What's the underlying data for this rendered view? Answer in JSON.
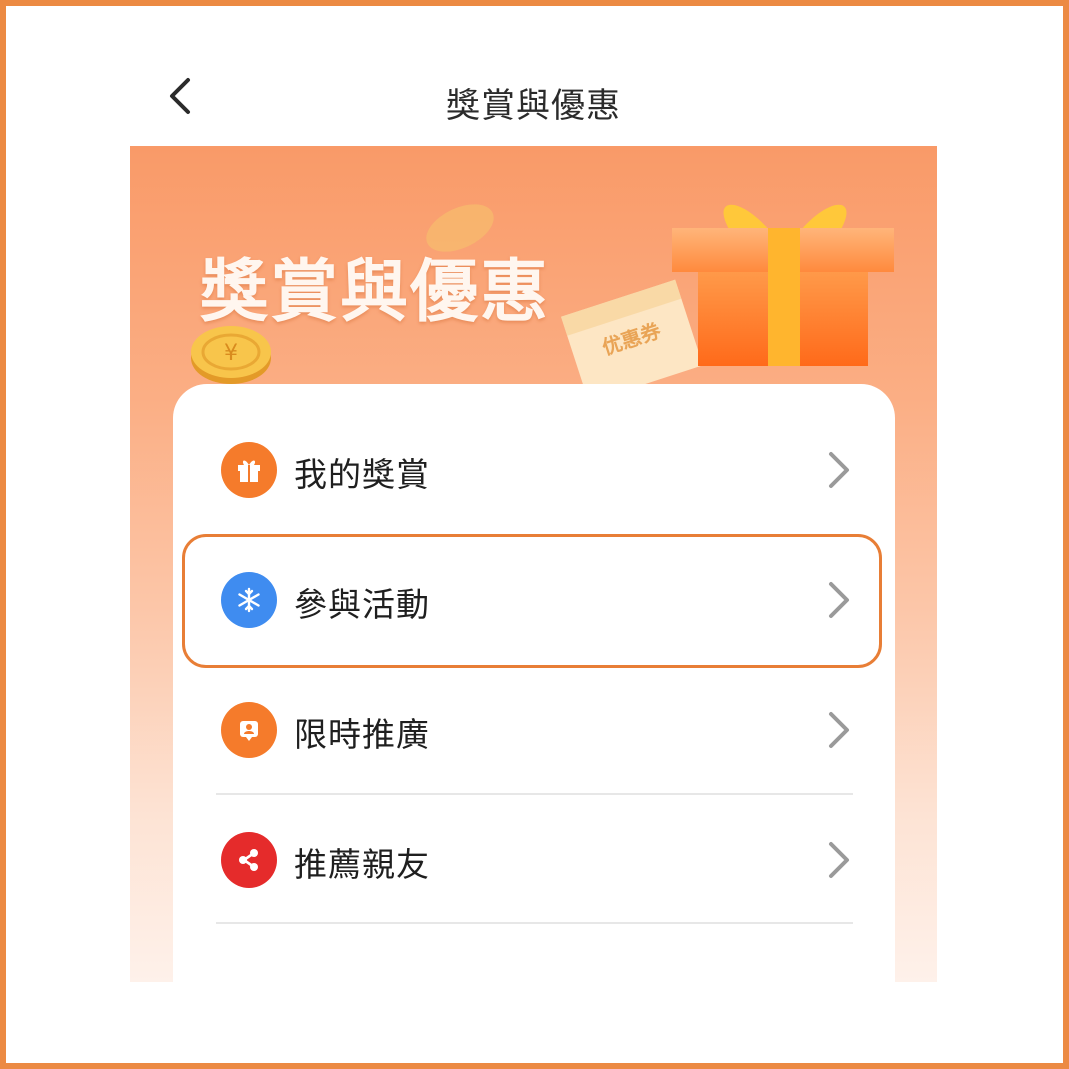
{
  "header": {
    "title": "獎賞與優惠",
    "back_icon": "chevron-left-icon"
  },
  "banner": {
    "title": "獎賞與優惠",
    "ticket_text": "优惠券"
  },
  "menu": {
    "items": [
      {
        "label": "我的獎賞",
        "icon": "gift-icon",
        "icon_color": "#f57b2b"
      },
      {
        "label": "參與活動",
        "icon": "snowflake-icon",
        "icon_color": "#3f8cf0"
      },
      {
        "label": "限時推廣",
        "icon": "user-badge-icon",
        "icon_color": "#f57b2b"
      },
      {
        "label": "推薦親友",
        "icon": "share-icon",
        "icon_color": "#e52b2b"
      }
    ]
  },
  "colors": {
    "frame": "#ec8a43",
    "highlight": "#e87e36",
    "chevron": "#9a9a9a"
  }
}
